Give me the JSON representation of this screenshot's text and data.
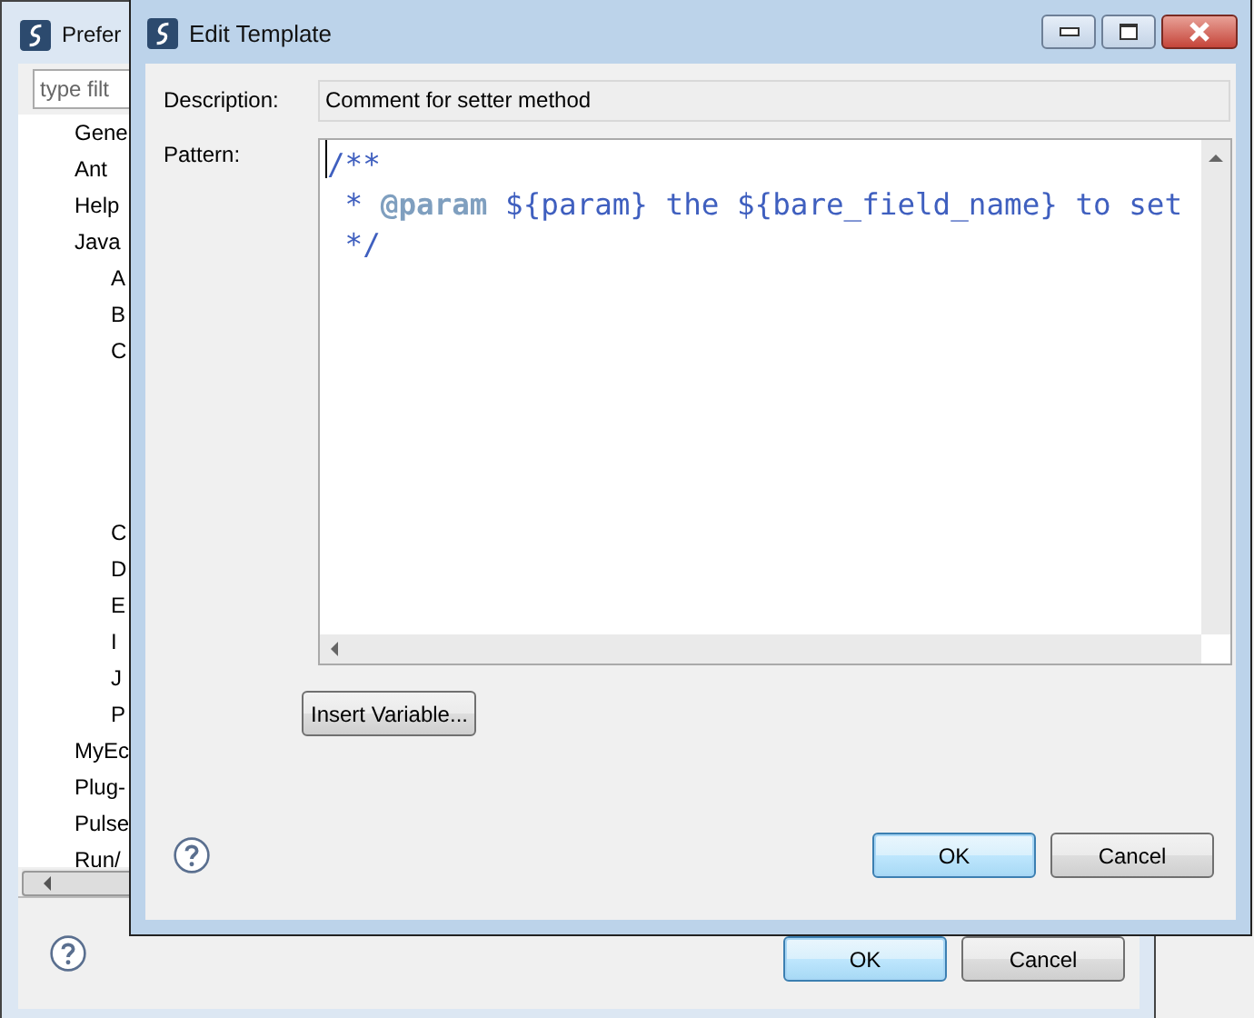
{
  "background_window": {
    "title": "Prefer",
    "filter": {
      "placeholder": "type filt"
    },
    "tree": [
      {
        "label": "Gene"
      },
      {
        "label": "Ant"
      },
      {
        "label": "Help"
      },
      {
        "label": "Java",
        "children": [
          {
            "label": "A"
          },
          {
            "label": "B"
          },
          {
            "label": "C"
          },
          {
            "label": "C"
          },
          {
            "label": "D"
          },
          {
            "label": "E"
          },
          {
            "label": "I"
          },
          {
            "label": "J"
          },
          {
            "label": "P"
          }
        ]
      },
      {
        "label": "MyEc"
      },
      {
        "label": "Plug-"
      },
      {
        "label": "Pulse"
      },
      {
        "label": "Run/"
      }
    ],
    "buttons": [
      {
        "label": "OK",
        "default": true
      },
      {
        "label": "Cancel",
        "default": false
      }
    ]
  },
  "dialog": {
    "title": "Edit Template",
    "description_label": "Description:",
    "description": "Comment for setter method",
    "pattern_label": "Pattern:",
    "pattern_lines": [
      "/**",
      " * **@param** ${param} the ${bare_field_name} to set",
      " */"
    ],
    "insert_button": "Insert Variable...",
    "buttons": [
      {
        "label": "OK",
        "default": true
      },
      {
        "label": "Cancel",
        "default": false
      }
    ]
  }
}
